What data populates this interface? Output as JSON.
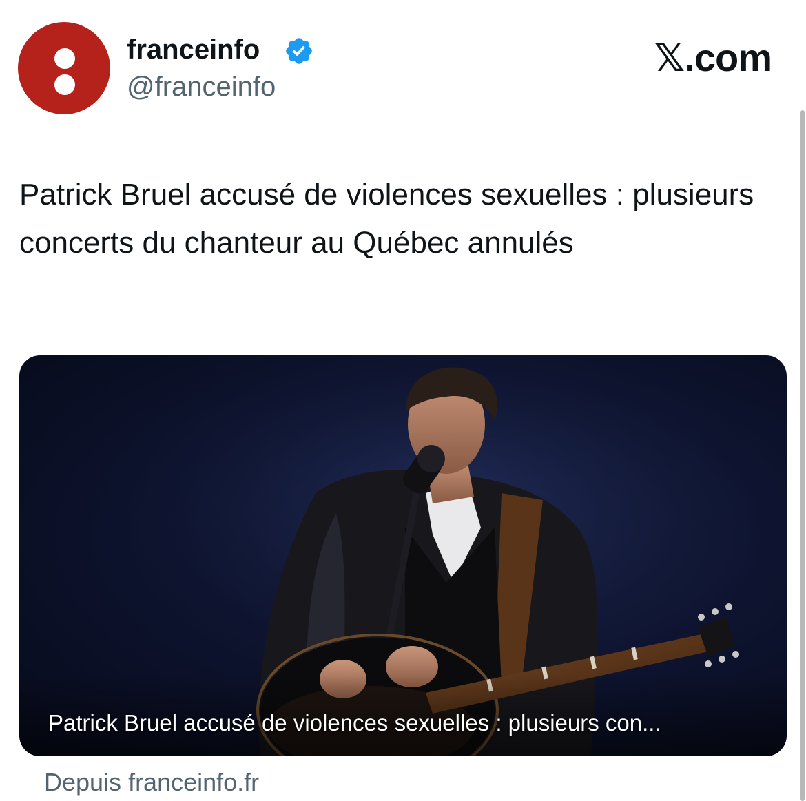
{
  "account": {
    "display_name": "franceinfo",
    "handle": "@franceinfo",
    "verified": true,
    "avatar_icon": "franceinfo-logo-icon",
    "avatar_color": "#b5221c"
  },
  "watermark": {
    "text": "𝕏.com"
  },
  "tweet": {
    "text": "Patrick Bruel accusé de violences sexuelles : plusieurs concerts du chanteur au Québec annulés"
  },
  "link_card": {
    "title": "Patrick Bruel accusé de violences sexuelles : plusieurs con...",
    "image_icon": "singer-with-guitar-photo"
  },
  "source": {
    "text": "Depuis franceinfo.fr"
  },
  "colors": {
    "text_primary": "#0f1419",
    "text_secondary": "#536471",
    "verified_blue": "#1d9bf0"
  }
}
